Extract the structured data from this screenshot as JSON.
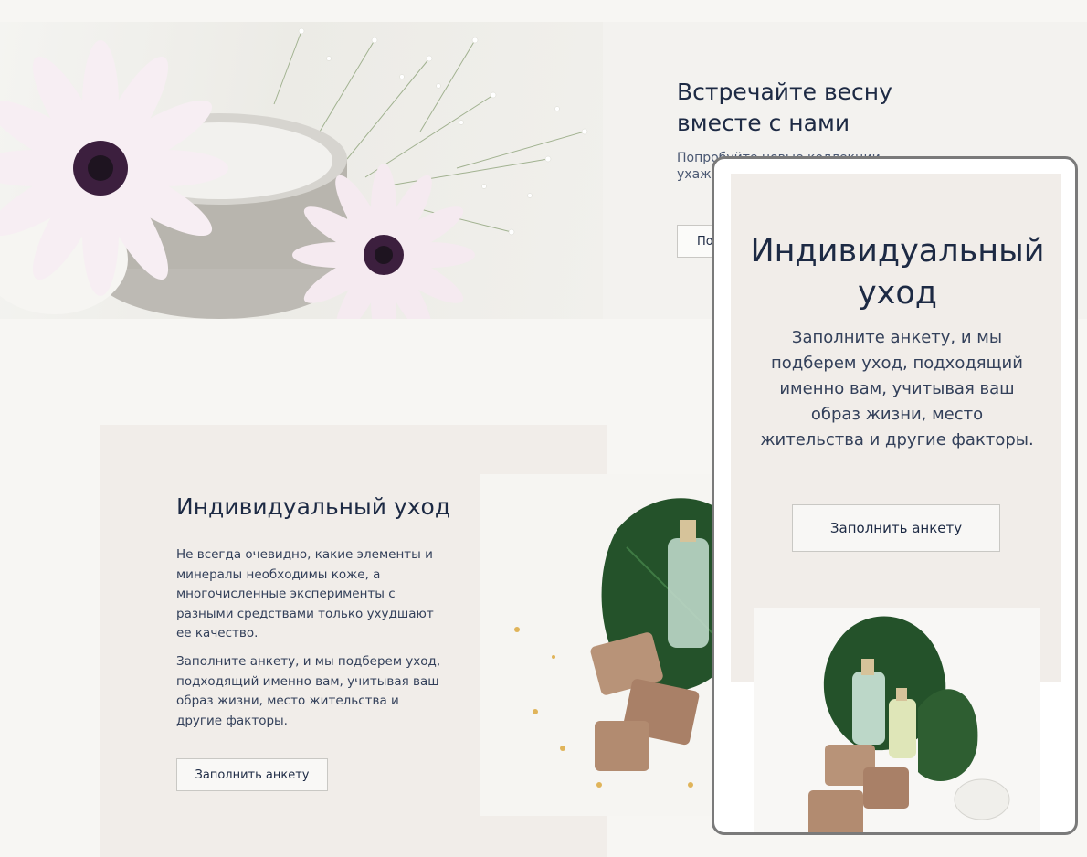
{
  "hero": {
    "title": "Встречайте весну вместе с нами",
    "subtitle": "Попробуйте новые коллекции ухаж... с SPF",
    "button_label": "По..."
  },
  "care_section": {
    "title": "Индивидуальный уход",
    "paragraph_1": "Не всегда очевидно, какие элементы и минералы необходимы коже, а многочисленные эксперименты с разными средствами только ухудшают ее качество.",
    "paragraph_2": "Заполните анкету, и мы подберем уход, подходящий именно вам, учитывая ваш образ жизни, место жительства и другие факторы.",
    "button_label": "Заполнить анкету"
  },
  "mobile_preview": {
    "title": "Индивидуальный уход",
    "text": "Заполните анкету, и мы подберем уход, подходящий именно вам, учитывая ваш образ жизни, место жительства и другие факторы.",
    "button_label": "Заполнить анкету"
  },
  "colors": {
    "background": "#f7f6f3",
    "card": "#f1ede9",
    "text_dark": "#1d2a44",
    "flower_center": "#3c1f3e",
    "leaf": "#1f4d22"
  }
}
